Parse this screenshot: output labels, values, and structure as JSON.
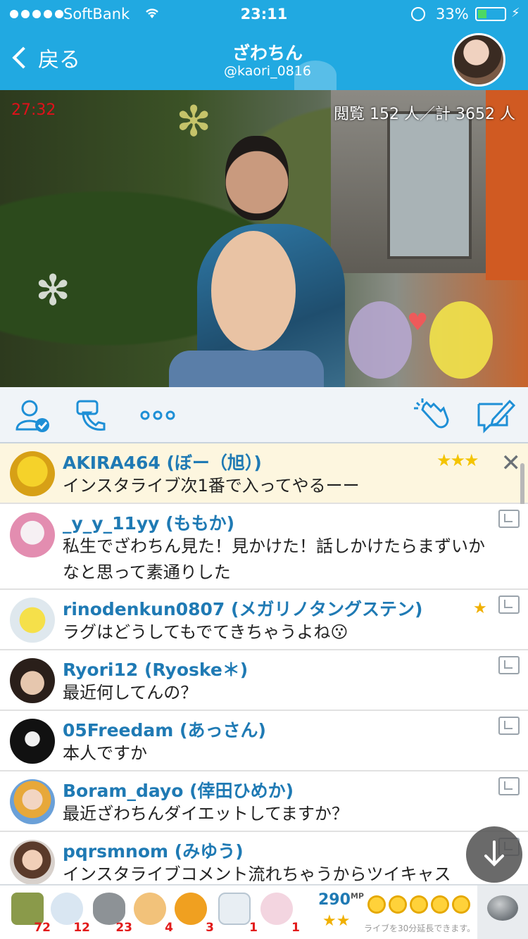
{
  "status_bar": {
    "carrier": "SoftBank",
    "time": "23:11",
    "battery": "33%",
    "battery_level": 0.33,
    "icons": [
      "signal-dots-icon",
      "wifi-icon",
      "rotation-lock-icon",
      "battery-icon",
      "charging-icon"
    ]
  },
  "nav": {
    "back_label": "戻る",
    "title": "ざわちん",
    "handle": "@kaori_0816"
  },
  "video": {
    "timer": "27:32",
    "viewers": "閲覧 152 人／計 3652 人"
  },
  "actions": [
    "profile-check-icon",
    "call-icon",
    "more-icon",
    "clap-icon",
    "compose-icon"
  ],
  "comments": [
    {
      "user": "AKIRA464 (ぼー（旭）)",
      "text": "インスタライブ次1番で入ってやるーー",
      "highlight": true,
      "badge": "three-stars"
    },
    {
      "user": "_y_y_11yy (ももか)",
      "text": "私生でざわちん見た！見かけた！話しかけたらまずいかなと思って素通りした"
    },
    {
      "user": "rinodenkun0807 (メガリノタングステン)",
      "text": "ラグはどうしてもでてきちゃうよね😗",
      "badge": "medal"
    },
    {
      "user": "Ryori12 (Ryoske＊)",
      "text": "最近何してんの？"
    },
    {
      "user": "05Freedam (あっさん)",
      "text": "本人ですか"
    },
    {
      "user": "Boram_dayo (倖田ひめか)",
      "text": "最近ざわちんダイエットしてますか？"
    },
    {
      "user": "pqrsmnom (みゆう)",
      "text": "インスタライブコメント流れちゃうからツイキャス"
    }
  ],
  "gifts": [
    {
      "icon": "tea-icon",
      "count": "72",
      "color": "#8a9a4a"
    },
    {
      "icon": "ghost-icon",
      "count": "12",
      "color": "#d9e6f2"
    },
    {
      "icon": "stone-icon",
      "count": "23",
      "color": "#8d9296"
    },
    {
      "icon": "clap-hands-icon",
      "count": "4",
      "color": "#f2c27a"
    },
    {
      "icon": "party-popper-icon",
      "count": "3",
      "color": "#f0a020"
    },
    {
      "icon": "bear-icon",
      "count": "1",
      "color": "#e8eef3"
    },
    {
      "icon": "bunny-icon",
      "count": "1",
      "color": "#f3d5e0"
    }
  ],
  "mp": {
    "value": "290",
    "unit": "MP",
    "stars": "★★",
    "extend_text": "ライブを30分延長できます。"
  },
  "colors": {
    "accent": "#21a9e1",
    "username": "#1f7ab4",
    "timer": "#e0101a",
    "count": "#e21a1a"
  }
}
